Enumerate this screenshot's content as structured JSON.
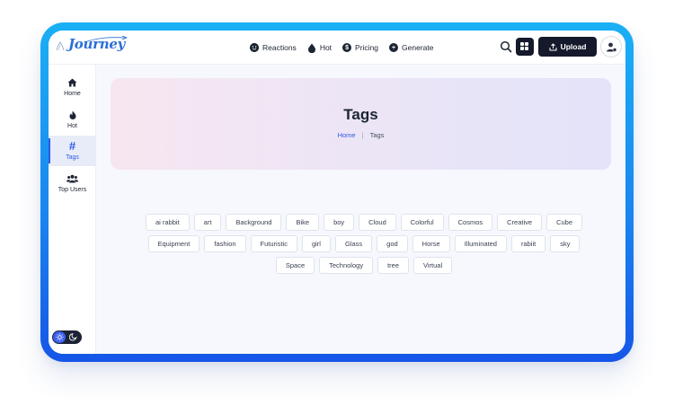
{
  "brand": {
    "name": "Journey"
  },
  "nav": [
    {
      "label": "Reactions",
      "icon": "smile-icon"
    },
    {
      "label": "Hot",
      "icon": "fire-icon"
    },
    {
      "label": "Pricing",
      "icon": "dollar-icon"
    },
    {
      "label": "Generate",
      "icon": "plus-circle-icon"
    }
  ],
  "header": {
    "upload_label": "Upload"
  },
  "sidebar": [
    {
      "label": "Home",
      "icon": "home-icon"
    },
    {
      "label": "Hot",
      "icon": "fire-icon"
    },
    {
      "label": "Tags",
      "icon": "hash-icon",
      "active": true
    },
    {
      "label": "Top Users",
      "icon": "users-icon"
    }
  ],
  "hero": {
    "title": "Tags",
    "breadcrumb": {
      "home": "Home",
      "current": "Tags"
    }
  },
  "tag_rows": [
    [
      "ai rabbit",
      "art",
      "Background",
      "Bike",
      "boy",
      "Cloud",
      "Colorful",
      "Cosmos",
      "Creative",
      "Cube"
    ],
    [
      "Equipment",
      "fashion",
      "Futuristic",
      "girl",
      "Glass",
      "god",
      "Horse",
      "Illuminated",
      "rabiit",
      "sky"
    ],
    [
      "Space",
      "Technology",
      "tree",
      "Virtual"
    ]
  ],
  "colors": {
    "accent": "#2d5be3",
    "dark": "#141a2b",
    "frame": "#1a86f0"
  }
}
